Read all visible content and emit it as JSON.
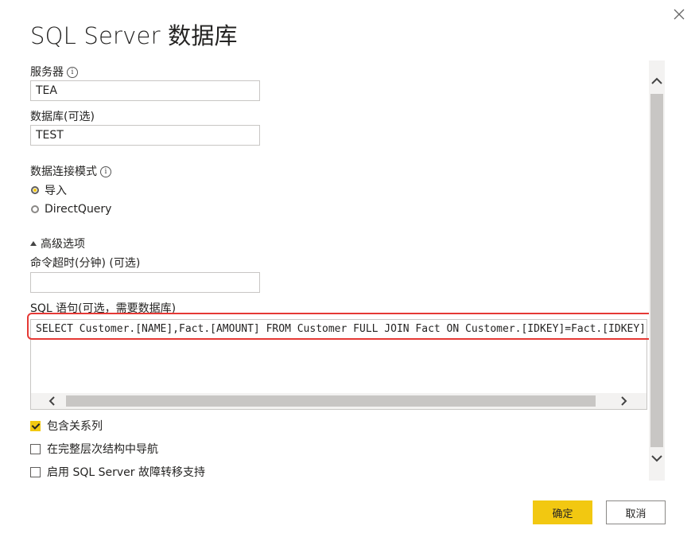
{
  "dialog": {
    "title": "SQL Server 数据库"
  },
  "server": {
    "label": "服务器",
    "value": "TEA"
  },
  "database": {
    "label": "数据库(可选)",
    "value": "TEST"
  },
  "connectivity": {
    "label": "数据连接模式",
    "options": [
      {
        "label": "导入",
        "selected": true
      },
      {
        "label": "DirectQuery",
        "selected": false
      }
    ]
  },
  "advanced": {
    "toggle_label": "高级选项",
    "timeout_label": "命令超时(分钟) (可选)",
    "timeout_value": "",
    "sql_label": "SQL 语句(可选，需要数据库)",
    "sql_value": "SELECT Customer.[NAME],Fact.[AMOUNT] FROM Customer FULL JOIN Fact ON Customer.[IDKEY]=Fact.[IDKEY]"
  },
  "checkboxes": [
    {
      "label": "包含关系列",
      "checked": true
    },
    {
      "label": "在完整层次结构中导航",
      "checked": false
    },
    {
      "label": "启用 SQL Server 故障转移支持",
      "checked": false
    }
  ],
  "buttons": {
    "ok": "确定",
    "cancel": "取消"
  },
  "info_glyph": "i",
  "colors": {
    "accent": "#f2c811",
    "highlight": "#e53935"
  }
}
